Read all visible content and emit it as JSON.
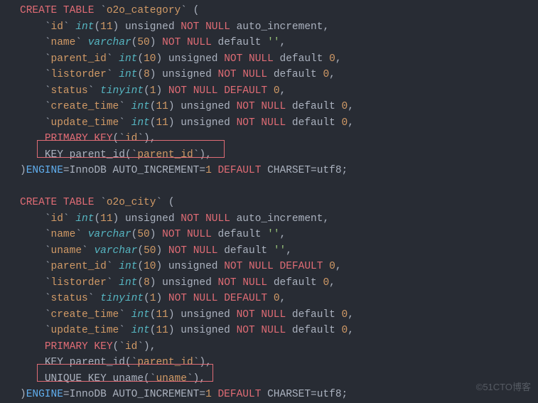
{
  "watermark": "©51CTO博客",
  "code": {
    "table1_name": "o2o_category",
    "table2_name": "o2o_city",
    "create": "CREATE",
    "table_kw": "TABLE",
    "not": "NOT",
    "null": "NULL",
    "default_kw": "default",
    "default_uc": "DEFAULT",
    "auto_inc": "auto_increment",
    "unsigned": "unsigned",
    "primary_key": "PRIMARY KEY",
    "key": "KEY",
    "unique_key": "UNIQUE KEY",
    "engine": "ENGINE",
    "innodb": "InnoDB",
    "auto_increment_opt": "AUTO_INCREMENT",
    "charset_kw": "CHARSET",
    "charset_val": "utf8",
    "t_int": "int",
    "t_varchar": "varchar",
    "t_tinyint": "tinyint",
    "col_id": "id",
    "col_name": "name",
    "col_uname": "uname",
    "col_parent_id": "parent_id",
    "col_listorder": "listorder",
    "col_status": "status",
    "col_create_time": "create_time",
    "col_update_time": "update_time",
    "n11": "11",
    "n50": "50",
    "n10": "10",
    "n8": "8",
    "n1": "1",
    "n0": "0",
    "idx_parent_id": "parent_id",
    "idx_uname": "uname",
    "empty_str": "''"
  }
}
